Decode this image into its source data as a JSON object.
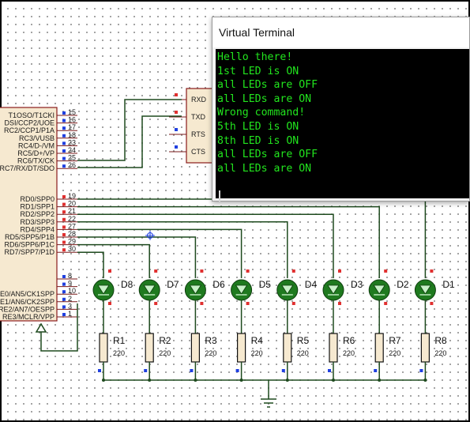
{
  "mcu": {
    "pins_upper": [
      {
        "label": "T1OSO/T1CKI",
        "num": "15"
      },
      {
        "label": "DSI/CCP2/UOE",
        "num": "16"
      },
      {
        "label": "RC2/CCP1/P1A",
        "num": "17"
      },
      {
        "label": "RC3/VUSB",
        "num": "18"
      },
      {
        "label": "RC4/D-/VM",
        "num": "23"
      },
      {
        "label": "RC5/D+/VP",
        "num": "24"
      },
      {
        "label": "RC6/TX/CK",
        "num": "25"
      },
      {
        "label": "RC7/RX/DT/SDO",
        "num": "26"
      }
    ],
    "pins_port_d": [
      {
        "label": "RD0/SPP0",
        "num": "19"
      },
      {
        "label": "RD1/SPP1",
        "num": "20"
      },
      {
        "label": "RD2/SPP2",
        "num": "21"
      },
      {
        "label": "RD3/SPP3",
        "num": "22"
      },
      {
        "label": "RD4/SPP4",
        "num": "27"
      },
      {
        "label": "RD5/SPP5/P1B",
        "num": "28"
      },
      {
        "label": "RD6/SPP6/P1C",
        "num": "29"
      },
      {
        "label": "RD7/SPP7/P1D",
        "num": "30"
      }
    ],
    "pins_lower": [
      {
        "label": "",
        "num": "8"
      },
      {
        "label": "",
        "num": "9"
      },
      {
        "label": "RE0/AN5/CK1SPP",
        "num": "10"
      },
      {
        "label": "RE1/AN6/CK2SPP",
        "num": "2"
      },
      {
        "label": "RE2/AN7/OESPP",
        "num": "3"
      },
      {
        "label": "RE3/MCLR/VPP",
        "num": "1"
      }
    ]
  },
  "uart": {
    "pins": [
      "RXD",
      "TXD",
      "RTS",
      "CTS"
    ]
  },
  "leds": [
    "D8",
    "D7",
    "D6",
    "D5",
    "D4",
    "D3",
    "D2",
    "D1"
  ],
  "resistors": [
    {
      "name": "R1",
      "value": "220"
    },
    {
      "name": "R2",
      "value": "220"
    },
    {
      "name": "R3",
      "value": "220"
    },
    {
      "name": "R4",
      "value": "220"
    },
    {
      "name": "R5",
      "value": "220"
    },
    {
      "name": "R6",
      "value": "220"
    },
    {
      "name": "R7",
      "value": "220"
    },
    {
      "name": "R8",
      "value": "220"
    }
  ],
  "terminal": {
    "title": "Virtual Terminal",
    "lines": [
      "Hello there!",
      "1st LED is ON",
      "all LEDs are OFF",
      "all LEDs are ON",
      "Wrong command!",
      "5th LED is ON",
      "8th LED is ON",
      "all LEDs are OFF",
      "all LEDs are ON"
    ]
  },
  "colors": {
    "led_fill": "#1f7a1f",
    "wire": "#1e4a1e",
    "terminal_bg": "#000000",
    "terminal_text": "#22e51e",
    "pin_high": "#e03030",
    "pin_low": "#2040e0"
  }
}
